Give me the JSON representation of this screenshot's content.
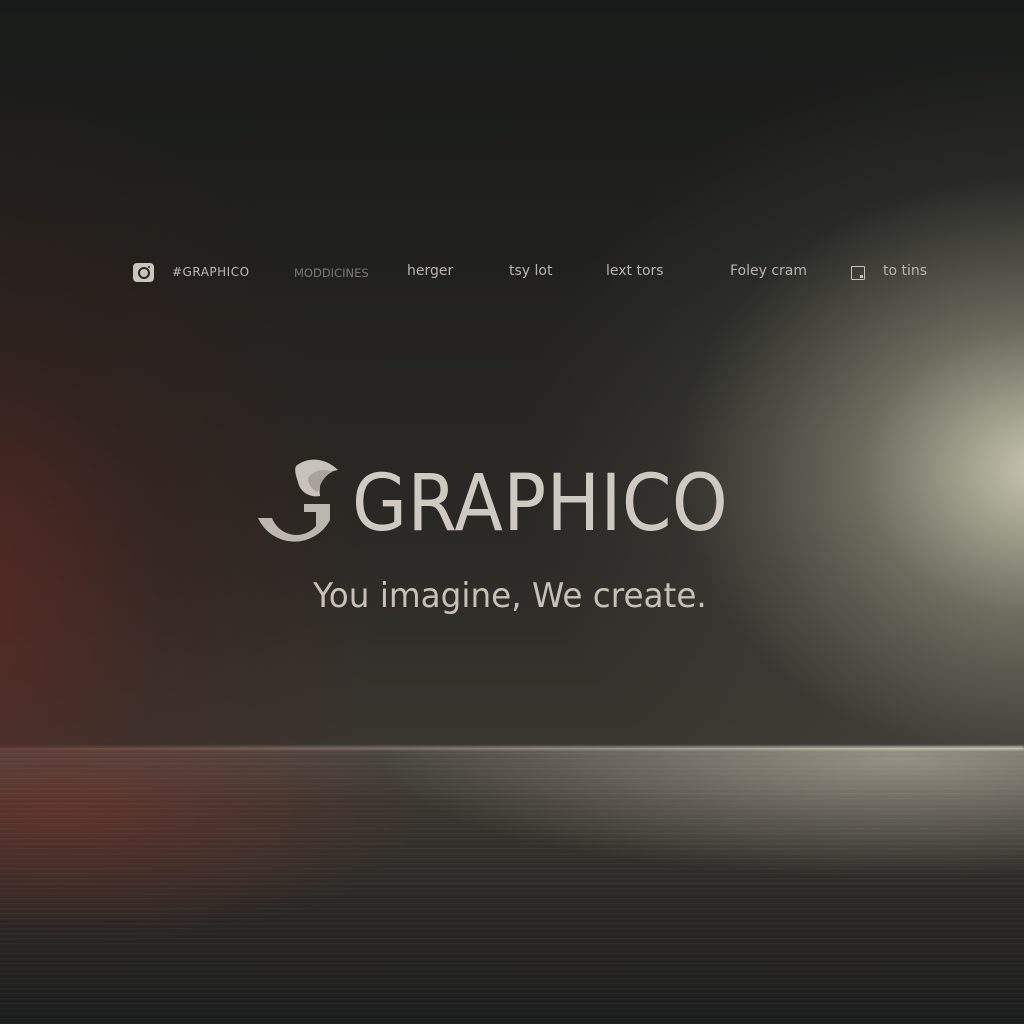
{
  "nav": {
    "brand_handle": "#GRAPHICO",
    "items": [
      {
        "label": "MODDICINES",
        "style": "dim"
      },
      {
        "label": "herger"
      },
      {
        "label": "tsy lot"
      },
      {
        "label": "lext tors"
      },
      {
        "label": "Foley cram"
      },
      {
        "label": "to tins"
      }
    ],
    "icons": [
      "instagram-icon",
      "square-icon"
    ]
  },
  "hero": {
    "logo_text": "GRAPHICO",
    "logo_icon": "graphico-logo-icon",
    "tagline": "You imagine, We create."
  },
  "colors": {
    "text": "#cfcac1",
    "nav_text": "#b8b4ad",
    "light_glow": "#d6d4ba",
    "red_glow": "#782820",
    "background": "#1a1b1a"
  }
}
